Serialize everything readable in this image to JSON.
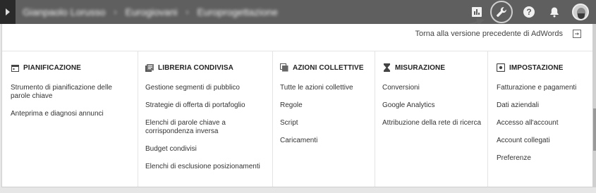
{
  "topbar": {
    "breadcrumbs": [
      "Gianpaolo Lorusso",
      "Eurogiovani",
      "Europrogettazione"
    ],
    "icons": [
      "reports-icon",
      "wrench-icon",
      "help-icon",
      "bell-icon",
      "avatar"
    ]
  },
  "panel": {
    "old_version_link": "Torna alla versione precedente di AdWords"
  },
  "columns": [
    {
      "title": "PIANIFICAZIONE",
      "icon": "calendar-icon",
      "items": [
        "Strumento di pianificazione delle parole chiave",
        "Anteprima e diagnosi annunci"
      ]
    },
    {
      "title": "LIBRERIA CONDIVISA",
      "icon": "library-icon",
      "items": [
        "Gestione segmenti di pubblico",
        "Strategie di offerta di portafoglio",
        "Elenchi di parole chiave a corrispondenza inversa",
        "Budget condivisi",
        "Elenchi di esclusione posizionamenti"
      ]
    },
    {
      "title": "AZIONI COLLETTIVE",
      "icon": "copy-icon",
      "items": [
        "Tutte le azioni collettive",
        "Regole",
        "Script",
        "Caricamenti"
      ]
    },
    {
      "title": "MISURAZIONE",
      "icon": "hourglass-icon",
      "items": [
        "Conversioni",
        "Google Analytics",
        "Attribuzione della rete di ricerca"
      ]
    },
    {
      "title": "IMPOSTAZIONE",
      "icon": "settings-icon",
      "items": [
        "Fatturazione e pagamenti",
        "Dati aziendali",
        "Accesso all'account",
        "Account collegati",
        "Preferenze"
      ]
    }
  ],
  "colors": {
    "topbar": "#5f5f5f",
    "panel_bg": "#ffffff",
    "divider": "#e4e4e4"
  }
}
